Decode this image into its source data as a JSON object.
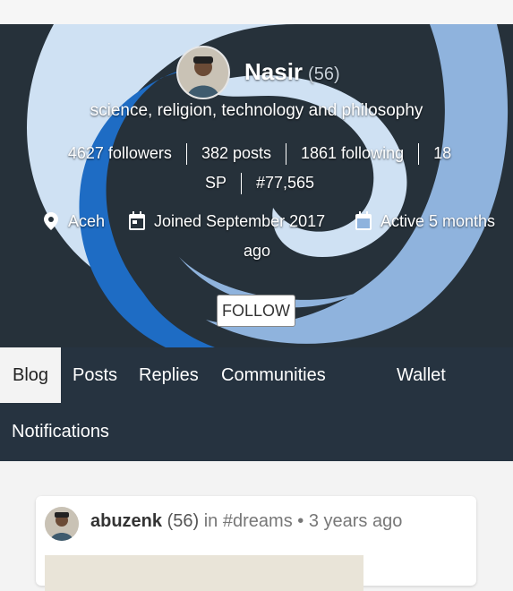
{
  "profile": {
    "name": "Nasir",
    "reputation": "(56)",
    "about": "science, religion, technology and philosophy",
    "followers": "4627 followers",
    "posts": "382 posts",
    "following": "1861 following",
    "sp_line1": "18",
    "sp_line2": "SP",
    "rank": "#77,565",
    "location": "Aceh",
    "joined": "Joined September 2017",
    "active": "Active 5 months",
    "active_cont": "ago",
    "follow_label": "FOLLOW"
  },
  "tabs": [
    {
      "label": "Blog",
      "active": true
    },
    {
      "label": "Posts"
    },
    {
      "label": "Replies"
    },
    {
      "label": "Communities"
    },
    {
      "label": "Wallet"
    },
    {
      "label": "Notifications"
    }
  ],
  "post": {
    "author": "abuzenk",
    "author_rep": "(56)",
    "in_text": "in",
    "community": "#dreams",
    "dot": "•",
    "time": "3 years ago"
  },
  "colors": {
    "hero_bg": "#26313a",
    "swirl_light": "#cfe1f3",
    "swirl_mid": "#8fb3dd",
    "swirl_dark": "#1e6cc4",
    "tabs_bg": "#263340"
  },
  "icons": {
    "location": "map-pin-icon",
    "joined": "calendar-icon",
    "active": "calendar-icon"
  }
}
